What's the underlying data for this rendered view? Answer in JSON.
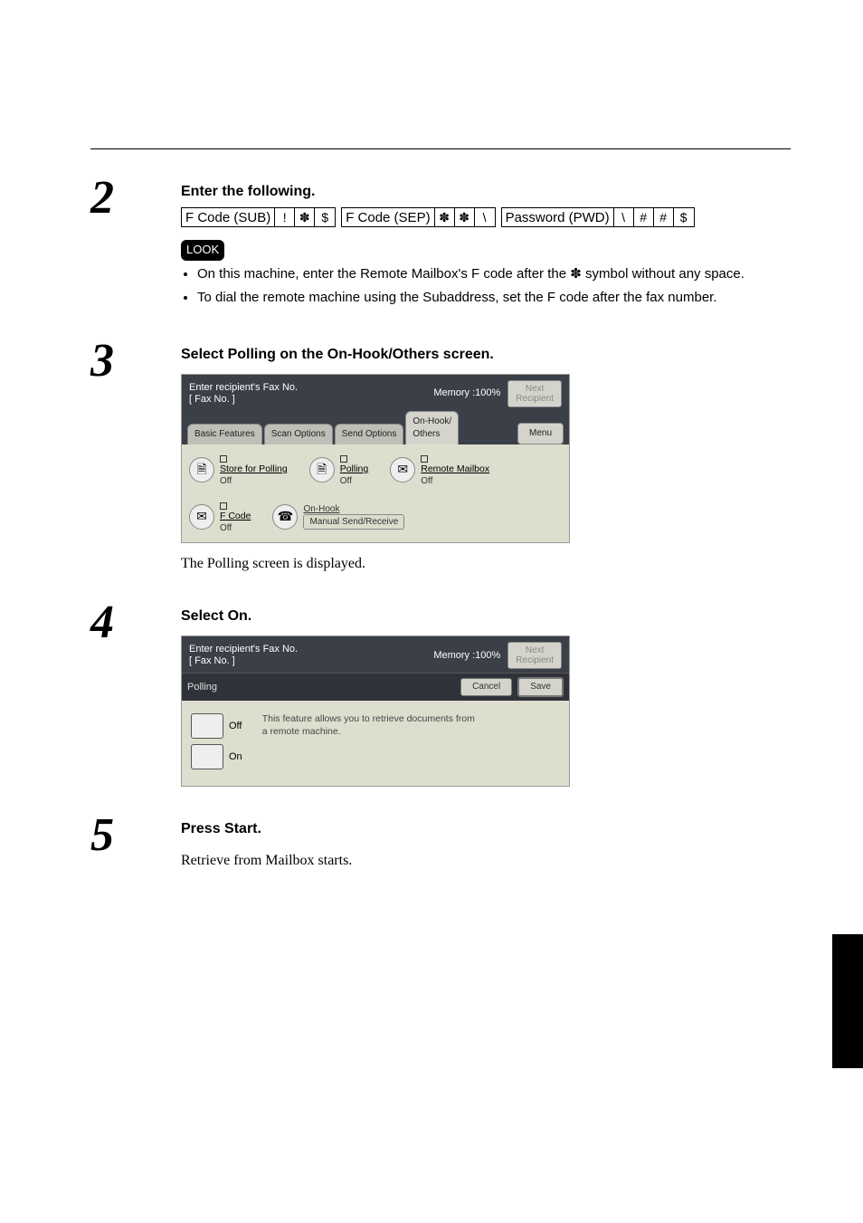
{
  "steps": {
    "s2": {
      "num": "2",
      "heading": "Enter the following.",
      "row_label_left": "F Code (SUB)",
      "row_keys_left": [
        "!",
        "✽",
        "$"
      ],
      "row_label_mid": "F Code (SEP)",
      "row_keys_mid": [
        "✽",
        "✽",
        "\\"
      ],
      "row_label_right": "Password (PWD)",
      "row_keys_right": [
        "\\",
        "#",
        "#",
        "$"
      ],
      "look_label": "LOOK",
      "bullet1_a": "On this machine, enter the Remote Mailbox's F code after the ",
      "bullet1_sym": "✽",
      "bullet1_b": " symbol without any space.",
      "bullet2": "To dial the remote machine using the Subaddress, set the F code after the fax number."
    },
    "s3": {
      "num": "3",
      "heading": "Select Polling on the On-Hook/Others screen.",
      "caption": "The Polling screen is displayed."
    },
    "s4": {
      "num": "4",
      "heading": "Select On."
    },
    "s5": {
      "num": "5",
      "heading": "Press Start.",
      "caption": "Retrieve from Mailbox starts."
    }
  },
  "screen1": {
    "header_line1": "Enter recipient's Fax No.",
    "header_line2": "[  Fax No. ]",
    "memory": "Memory :100%",
    "next_btn_l1": "Next",
    "next_btn_l2": "Recipient",
    "tabs": {
      "basic": "Basic Features",
      "scan": "Scan Options",
      "send": "Send Options",
      "onhook": "On-Hook/\nOthers",
      "menu": "Menu"
    },
    "opts": {
      "store_t": "Store for Polling",
      "store_s": "Off",
      "polling_t": "Polling",
      "polling_s": "Off",
      "remote_t": "Remote Mailbox",
      "remote_s": "Off",
      "fcode_t": "F Code",
      "fcode_s": "Off",
      "onhook_t": "On-Hook",
      "manual_btn": "Manual Send/Receive"
    }
  },
  "screen2": {
    "header_line1": "Enter recipient's Fax No.",
    "header_line2": "[  Fax No. ]",
    "memory": "Memory :100%",
    "next_btn_l1": "Next",
    "next_btn_l2": "Recipient",
    "bar_label": "Polling",
    "cancel": "Cancel",
    "save": "Save",
    "off": "Off",
    "on": "On",
    "desc": "This feature allows you to retrieve documents from a remote machine."
  }
}
